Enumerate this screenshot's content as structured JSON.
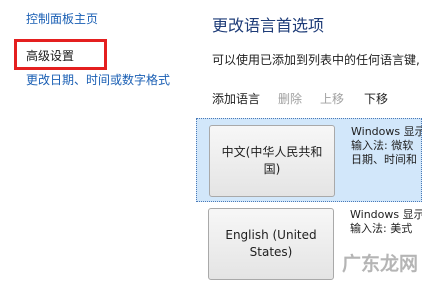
{
  "sidebar": {
    "items": [
      {
        "label": "控制面板主页"
      },
      {
        "label": "高级设置"
      },
      {
        "label": "更改日期、时间或数字格式"
      }
    ]
  },
  "main": {
    "title": "更改语言首选项",
    "description": "可以使用已添加到列表中的任何语言键,",
    "toolbar": {
      "add_label": "添加语言",
      "delete_label": "删除",
      "up_label": "上移",
      "down_label": "下移"
    },
    "languages": [
      {
        "name": "中文(中华人民共和国)",
        "info": [
          "Windows 显示",
          "输入法: 微软",
          "日期、时间和"
        ]
      },
      {
        "name": "English (United States)",
        "info": [
          "Windows 显示",
          "输入法: 美式"
        ]
      }
    ]
  },
  "watermark": {
    "text": "广东龙网"
  },
  "colors": {
    "highlight_box": "#e41f1f",
    "selected_row": "#d2e7fa",
    "link": "#1a5fb4"
  }
}
